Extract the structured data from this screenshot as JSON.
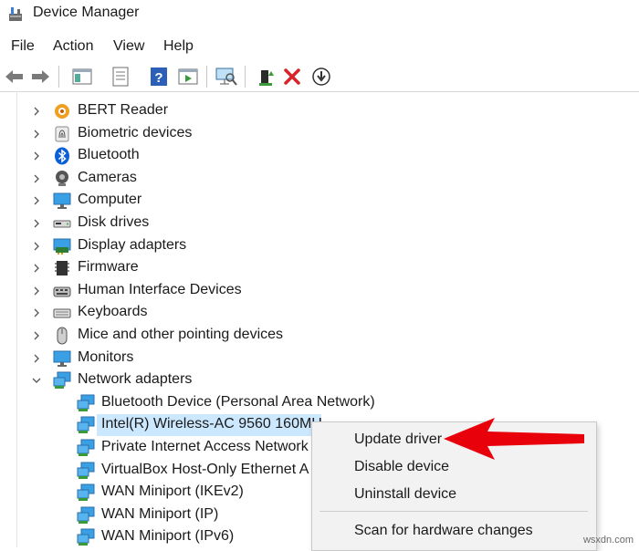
{
  "window": {
    "title": "Device Manager"
  },
  "menu": [
    "File",
    "Action",
    "View",
    "Help"
  ],
  "toolbar": [
    {
      "icon": "back-arrow-icon"
    },
    {
      "icon": "forward-arrow-icon"
    },
    {
      "icon": "show-hide-console-tree-icon"
    },
    {
      "icon": "properties-icon"
    },
    {
      "icon": "help-icon"
    },
    {
      "icon": "run-icon"
    },
    {
      "icon": "scan-hardware-changes-icon"
    },
    {
      "icon": "update-driver-icon"
    },
    {
      "icon": "uninstall-icon"
    },
    {
      "icon": "disable-download-icon"
    }
  ],
  "categories": [
    {
      "label": "BERT Reader",
      "icon": "bert-reader-icon"
    },
    {
      "label": "Biometric devices",
      "icon": "fingerprint-icon"
    },
    {
      "label": "Bluetooth",
      "icon": "bluetooth-icon"
    },
    {
      "label": "Cameras",
      "icon": "camera-icon"
    },
    {
      "label": "Computer",
      "icon": "computer-icon"
    },
    {
      "label": "Disk drives",
      "icon": "disk-drive-icon"
    },
    {
      "label": "Display adapters",
      "icon": "display-adapter-icon"
    },
    {
      "label": "Firmware",
      "icon": "firmware-icon"
    },
    {
      "label": "Human Interface Devices",
      "icon": "hid-icon"
    },
    {
      "label": "Keyboards",
      "icon": "keyboard-icon"
    },
    {
      "label": "Mice and other pointing devices",
      "icon": "mouse-icon"
    },
    {
      "label": "Monitors",
      "icon": "monitor-icon"
    },
    {
      "label": "Network adapters",
      "icon": "network-adapter-icon",
      "expanded": true
    }
  ],
  "network_children": [
    {
      "label": "Bluetooth Device (Personal Area Network)"
    },
    {
      "label": "Intel(R) Wireless-AC 9560 160MH",
      "selected": true
    },
    {
      "label": "Private Internet Access Network A"
    },
    {
      "label": "VirtualBox Host-Only Ethernet A"
    },
    {
      "label": "WAN Miniport (IKEv2)"
    },
    {
      "label": "WAN Miniport (IP)"
    },
    {
      "label": "WAN Miniport (IPv6)"
    }
  ],
  "context_menu": {
    "items": [
      "Update driver",
      "Disable device",
      "Uninstall device",
      "Scan for hardware changes"
    ],
    "highlighted": "Update driver"
  },
  "watermark": "wsxdn.com",
  "colors": {
    "selection": "#cce8ff",
    "arrow": "#e8000b",
    "menu_bg": "#f2f2f2"
  }
}
